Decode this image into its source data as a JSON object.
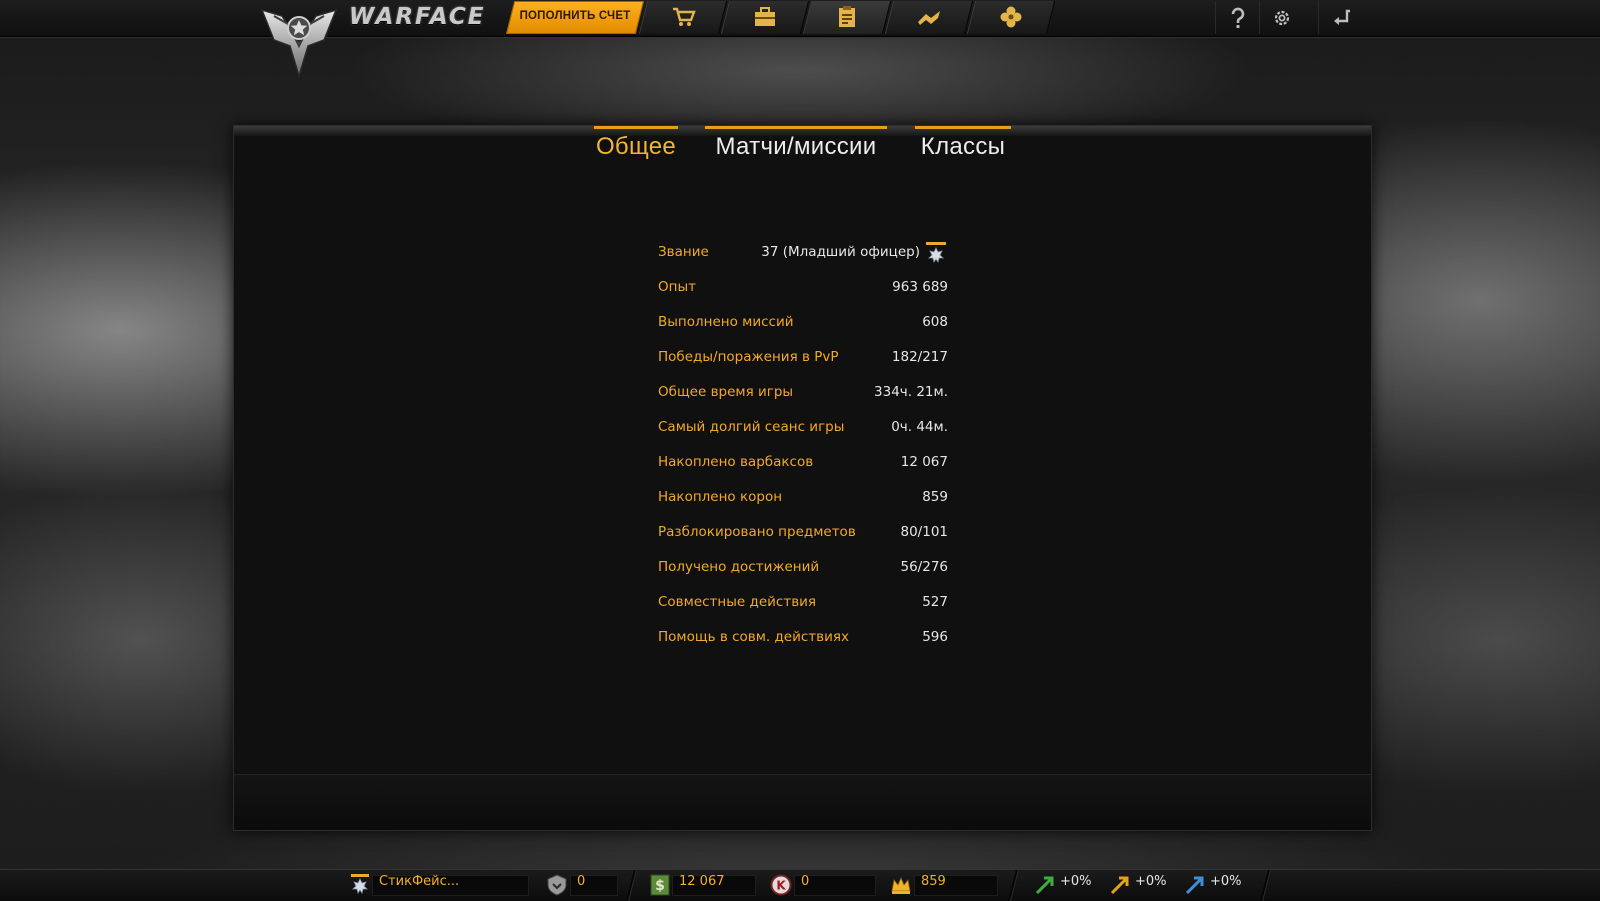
{
  "app": {
    "logo_text": "WARFACE",
    "topup_label": "ПОПОЛНИТЬ СЧЕТ"
  },
  "nav": {
    "tabs": [
      {
        "icon": "shopping-cart-icon"
      },
      {
        "icon": "inventory-chest-icon"
      },
      {
        "icon": "clipboard-stats-icon",
        "active": true
      },
      {
        "icon": "rank-chevron-icon"
      },
      {
        "icon": "clan-flower-icon"
      }
    ],
    "right": [
      {
        "icon": "help-icon"
      },
      {
        "icon": "settings-gear-icon"
      },
      {
        "icon": "exit-back-icon"
      }
    ]
  },
  "tabs": [
    {
      "label": "Общее",
      "active": true
    },
    {
      "label": "Матчи/миссии",
      "active": false
    },
    {
      "label": "Классы",
      "active": false
    }
  ],
  "stats": [
    {
      "label": "Звание",
      "value": "37 (Младший офицер)"
    },
    {
      "label": "Опыт",
      "value": "963 689"
    },
    {
      "label": "Выполнено миссий",
      "value": "608"
    },
    {
      "label": "Победы/поражения в PvP",
      "value": "182/217"
    },
    {
      "label": "Общее время игры",
      "value": "334ч. 21м."
    },
    {
      "label": "Самый долгий сеанс игры",
      "value": "0ч. 44м."
    },
    {
      "label": "Накоплено варбаксов",
      "value": "12 067"
    },
    {
      "label": "Накоплено корон",
      "value": "859"
    },
    {
      "label": "Разблокировано предметов",
      "value": "80/101"
    },
    {
      "label": "Получено достижений",
      "value": "56/276"
    },
    {
      "label": "Совместные действия",
      "value": "527"
    },
    {
      "label": "Помощь в совм. действиях",
      "value": "596"
    }
  ],
  "bottombar": {
    "player_name": "СтикФейс...",
    "vip_value": "0",
    "warbucks": "12 067",
    "kredits": "0",
    "crowns": "859",
    "boost_xp": "+0%",
    "boost_money": "+0%",
    "boost_vp": "+0%"
  },
  "colors": {
    "accent": "#f2a923",
    "tab_underline": "#e7a016",
    "value_text": "#e6e6e6"
  }
}
